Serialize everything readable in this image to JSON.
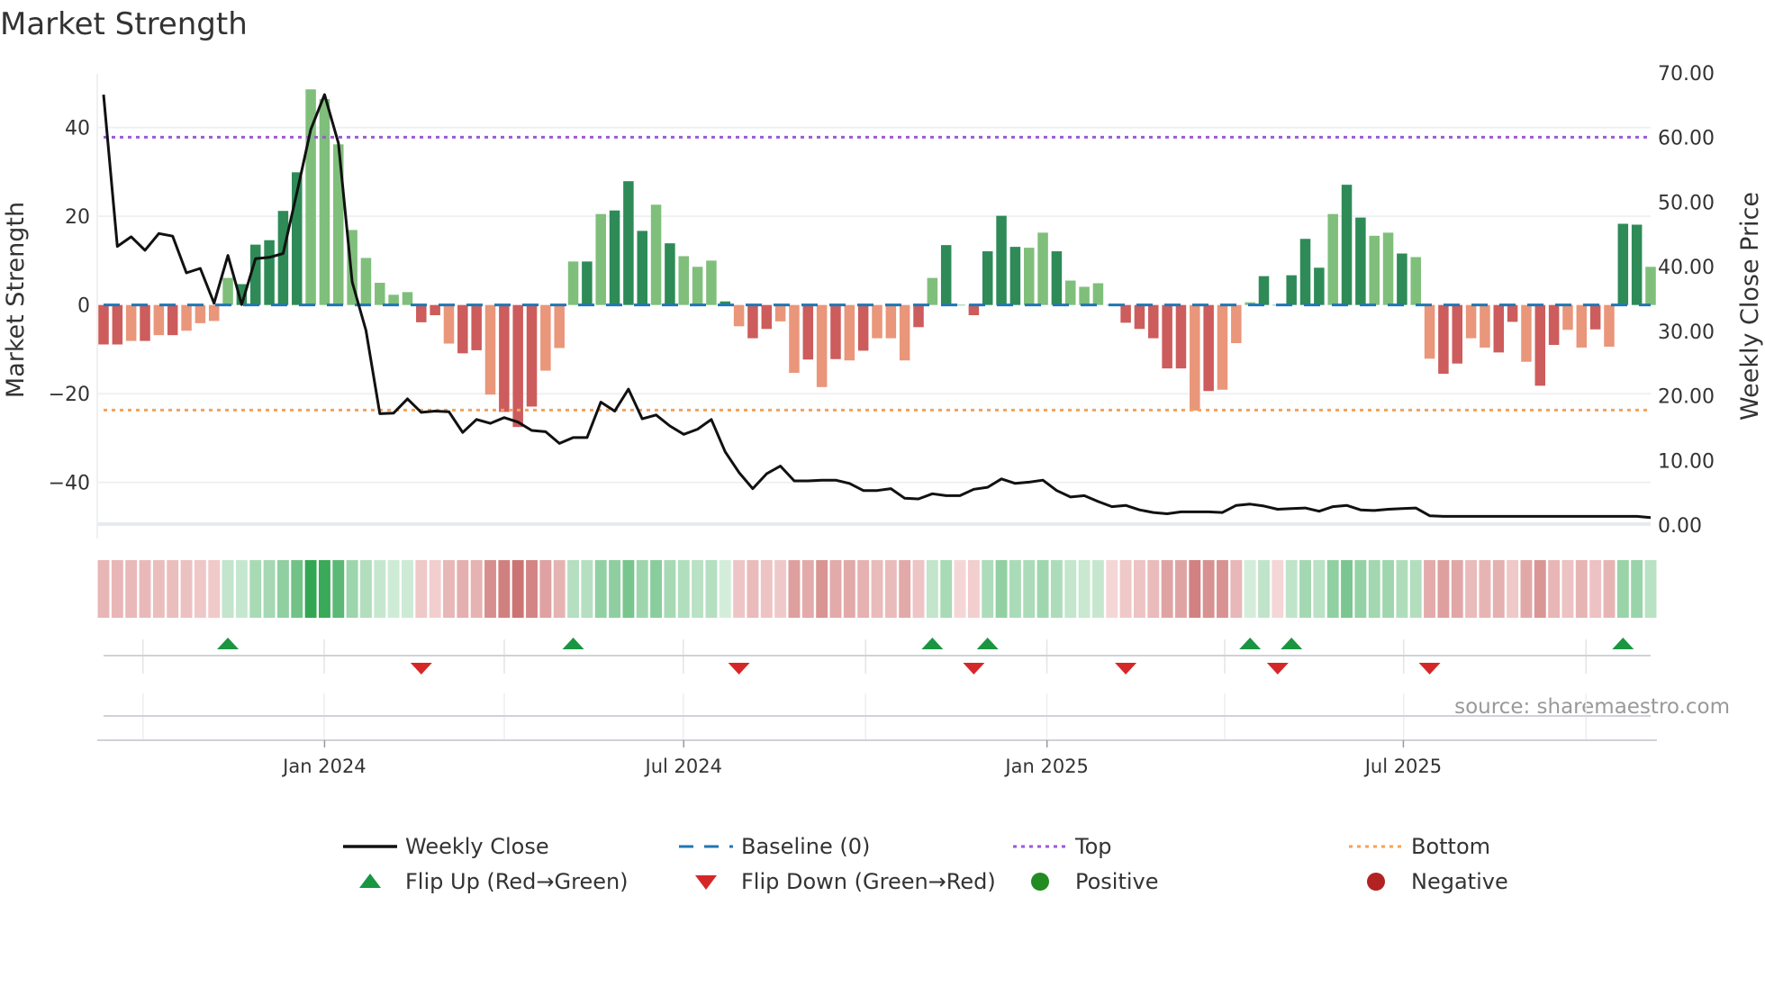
{
  "chart_data": {
    "type": "bar",
    "title": "Market Strength",
    "ylabel": "Market Strength",
    "y2label": "Weekly Close Price",
    "ylim": [
      -50,
      52.5
    ],
    "y2lim": [
      0,
      70
    ],
    "yticks": [
      "40",
      "20",
      "0",
      "−20",
      "−40"
    ],
    "ytick_values": [
      40,
      20,
      0,
      -20,
      -40
    ],
    "y2ticks": [
      "70.00",
      "60.00",
      "50.00",
      "40.00",
      "30.00",
      "20.00",
      "10.00",
      "0.00"
    ],
    "y2tick_values": [
      70,
      60,
      50,
      40,
      30,
      20,
      10,
      0
    ],
    "xticks": [
      {
        "label": "Jan 2024",
        "week": 17
      },
      {
        "label": "Jul 2024",
        "week": 43
      },
      {
        "label": "Jan 2025",
        "week": 69.3
      },
      {
        "label": "Jul 2025",
        "week": 95.1
      }
    ],
    "top_level": 37.8,
    "bottom_level": -23.7,
    "baseline": 0,
    "strength": [
      -8.9,
      -8.9,
      -8.1,
      -8.1,
      -6.8,
      -6.8,
      -5.8,
      -4.1,
      -3.6,
      6.1,
      4.7,
      13.6,
      14.6,
      21.2,
      29.9,
      48.6,
      46.4,
      36.2,
      16.9,
      10.6,
      5.0,
      2.3,
      2.9,
      -3.9,
      -2.3,
      -8.7,
      -10.9,
      -10.2,
      -20.2,
      -24.1,
      -27.5,
      -22.9,
      -14.8,
      -9.7,
      9.8,
      9.8,
      20.5,
      21.3,
      27.9,
      16.7,
      22.6,
      13.9,
      11.0,
      8.6,
      10.0,
      0.8,
      -4.8,
      -7.5,
      -5.4,
      -3.7,
      -15.3,
      -12.3,
      -18.5,
      -12.2,
      -12.5,
      -10.3,
      -7.5,
      -7.5,
      -12.5,
      -5.0,
      6.1,
      13.5,
      0,
      -2.3,
      12.1,
      20.1,
      13.1,
      12.9,
      16.3,
      12.1,
      5.5,
      4.1,
      4.9,
      0,
      -4.0,
      -5.4,
      -7.5,
      -14.3,
      -14.3,
      -23.8,
      -19.4,
      -19.1,
      -8.6,
      0.6,
      6.5,
      0,
      6.7,
      14.9,
      8.4,
      20.5,
      27.1,
      19.7,
      15.6,
      16.3,
      11.6,
      10.8,
      -12.1,
      -15.5,
      -13.2,
      -7.5,
      -9.6,
      -10.7,
      -3.8,
      -12.8,
      -18.2,
      -9.0,
      -5.6,
      -9.6,
      -5.5,
      -9.4,
      18.3,
      18.1,
      8.6
    ],
    "shade": "ddldldlllldddddllllllllddlddldddllldldddldllldlddlldldldllldlddddddlldlllddddddldllldddddlddlldllddllddlddlldlddll",
    "weekly_close": [
      66.5,
      43.0,
      44.5,
      42.4,
      45.0,
      44.6,
      38.9,
      39.6,
      34.2,
      41.6,
      34.0,
      41.1,
      41.3,
      41.9,
      51.4,
      61.1,
      66.5,
      59.0,
      37.5,
      30.0,
      17.1,
      17.2,
      19.4,
      17.3,
      17.5,
      17.4,
      14.2,
      16.2,
      15.6,
      16.5,
      15.8,
      14.5,
      14.3,
      12.5,
      13.4,
      13.4,
      18.9,
      17.5,
      20.9,
      16.3,
      16.9,
      15.2,
      13.9,
      14.7,
      16.2,
      11.2,
      8.0,
      5.5,
      7.8,
      9.0,
      6.7,
      6.7,
      6.8,
      6.8,
      6.3,
      5.2,
      5.2,
      5.5,
      4.0,
      3.9,
      4.7,
      4.4,
      4.4,
      5.4,
      5.7,
      7.0,
      6.3,
      6.5,
      6.8,
      5.2,
      4.2,
      4.4,
      3.5,
      2.7,
      2.9,
      2.2,
      1.8,
      1.6,
      1.9,
      1.9,
      1.9,
      1.8,
      2.9,
      3.1,
      2.8,
      2.3,
      2.4,
      2.5,
      2.0,
      2.7,
      2.9,
      2.2,
      2.1,
      2.3,
      2.4,
      2.5,
      1.3,
      1.2,
      1.2,
      1.2,
      1.2,
      1.2,
      1.2,
      1.2,
      1.2,
      1.2,
      1.2,
      1.2,
      1.2,
      1.2,
      1.2,
      1.2,
      1.0
    ],
    "flip_up_weeks": [
      10,
      35,
      61,
      65,
      84,
      87,
      111
    ],
    "flip_down_weeks": [
      24,
      47,
      64,
      75,
      86,
      97
    ],
    "legend": [
      {
        "label": "Weekly Close",
        "kind": "line",
        "color": "#111111"
      },
      {
        "label": "Baseline (0)",
        "kind": "dash",
        "color": "#1f77b4"
      },
      {
        "label": "Top",
        "kind": "dot",
        "color": "#9b59d6"
      },
      {
        "label": "Bottom",
        "kind": "dot",
        "color": "#f4a259"
      },
      {
        "label": "Flip Up (Red→Green)",
        "kind": "tri-up",
        "color": "#1a9641"
      },
      {
        "label": "Flip Down (Green→Red)",
        "kind": "tri-down",
        "color": "#d62728"
      },
      {
        "label": "Positive",
        "kind": "circle",
        "color": "#228b22"
      },
      {
        "label": "Negative",
        "kind": "circle",
        "color": "#b22222"
      }
    ],
    "legend_placement": "bottom",
    "source": "source: sharemaestro.com",
    "colors": {
      "pos_strong": "#2e8b57",
      "pos_weak": "#7fbf7b",
      "neg_strong": "#cd5c5c",
      "neg_weak": "#e9967a"
    }
  }
}
